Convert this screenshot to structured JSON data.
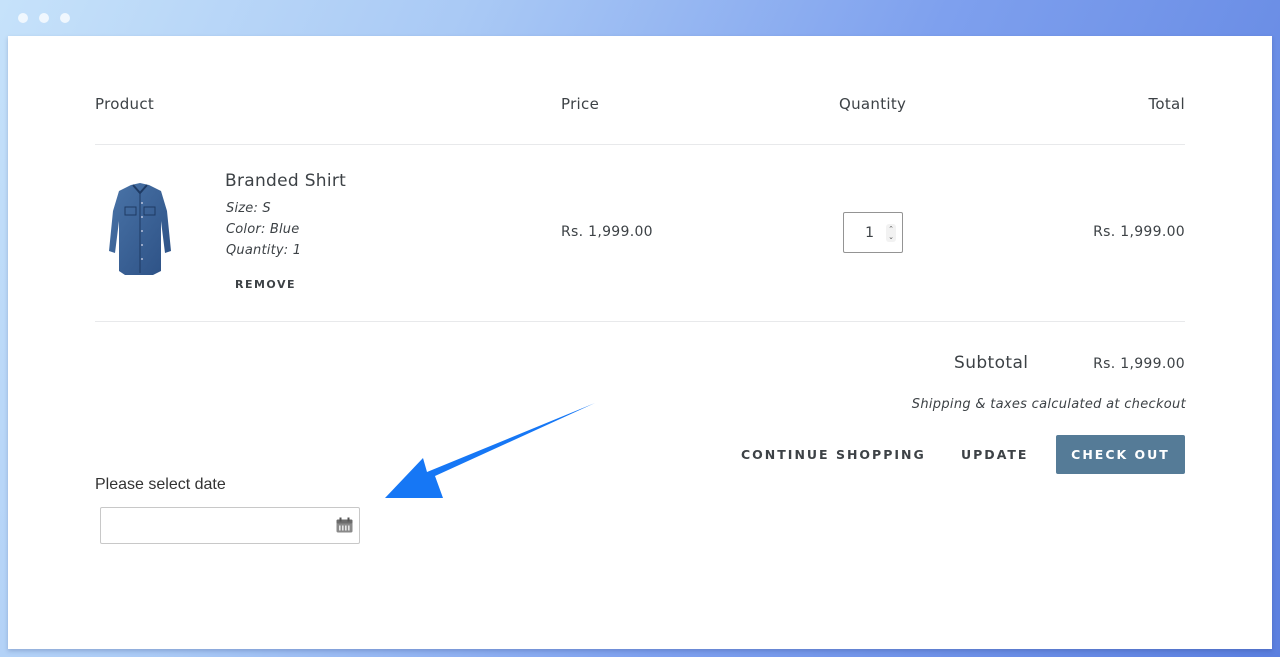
{
  "window": {
    "controls": [
      "close",
      "minimize",
      "maximize"
    ]
  },
  "cart": {
    "headers": {
      "product": "Product",
      "price": "Price",
      "quantity": "Quantity",
      "total": "Total"
    },
    "items": [
      {
        "image_icon": "shirt-image",
        "title": "Branded Shirt",
        "size": "Size: S",
        "color": "Color: Blue",
        "quantity_text": "Quantity: 1",
        "remove_label": "REMOVE",
        "price": "Rs. 1,999.00",
        "quantity_value": "1",
        "total": "Rs. 1,999.00"
      }
    ],
    "subtotal_label": "Subtotal",
    "subtotal_value": "Rs. 1,999.00",
    "shipping_note": "Shipping & taxes calculated at checkout",
    "buttons": {
      "continue_shopping": "CONTINUE SHOPPING",
      "update": "UPDATE",
      "checkout": "CHECK OUT"
    }
  },
  "date_picker": {
    "label": "Please select date",
    "value": "",
    "icon": "calendar-icon"
  },
  "annotation": {
    "icon": "arrow-pointer-icon",
    "color": "#1677f5"
  },
  "colors": {
    "checkout_button": "#557b97",
    "text": "#3d4246",
    "divider": "#e8e9eb"
  }
}
